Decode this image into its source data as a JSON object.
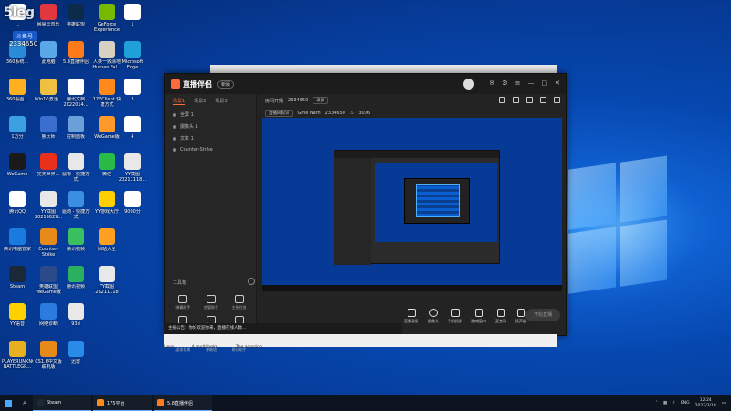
{
  "overlay": {
    "logo_text": "5leg",
    "badge": "斗鱼号",
    "room_id": "2334650"
  },
  "desktop_icons": [
    {
      "label": "...",
      "color": "#ffffff"
    },
    {
      "label": "网易云音乐",
      "color": "#e0383e"
    },
    {
      "label": "英雄联盟",
      "color": "#0c2a4a"
    },
    {
      "label": "GeForce Experience",
      "color": "#76b900"
    },
    {
      "label": "360系统...",
      "color": "#2a8cd8"
    },
    {
      "label": "此电脑",
      "color": "#5aa8e8"
    },
    {
      "label": "5.8直播伴侣",
      "color": "#ff7a1a"
    },
    {
      "label": "人类一败涂地 Human Fal...",
      "color": "#d8d0c0"
    },
    {
      "label": "1",
      "color": "#ffffff"
    },
    {
      "label": "360看图...",
      "color": "#ffb020"
    },
    {
      "label": "Win10激活...",
      "color": "#f0c040"
    },
    {
      "label": "腾讯文档 2022014...",
      "color": "#ffffff"
    },
    {
      "label": "175Client 快捷方式",
      "color": "#ff8a1a"
    },
    {
      "label": "Microsoft Edge",
      "color": "#1fa0d8"
    },
    {
      "label": "1万分",
      "color": "#3aa0e0"
    },
    {
      "label": "鲁大师",
      "color": "#3a6fd0"
    },
    {
      "label": "控制面板",
      "color": "#6a9fd8"
    },
    {
      "label": "WeGame版",
      "color": "#ff9a2a"
    },
    {
      "label": "3",
      "color": "#ffffff"
    },
    {
      "label": "WeGame",
      "color": "#1a1a1a"
    },
    {
      "label": "完美世界...",
      "color": "#e8301a"
    },
    {
      "label": "鼠标 - 快捷方式",
      "color": "#e8e8e8"
    },
    {
      "label": "微信",
      "color": "#2aba4a"
    },
    {
      "label": "4",
      "color": "#ffffff"
    },
    {
      "label": "腾讯QQ",
      "color": "#ffffff"
    },
    {
      "label": "YY截图 20210829...",
      "color": "#e8e8e8"
    },
    {
      "label": "驱动 - 快捷方式",
      "color": "#3a8fe0"
    },
    {
      "label": "YY游戏大厅",
      "color": "#ffd000"
    },
    {
      "label": "YY截图 20211118...",
      "color": "#e8e8e8"
    },
    {
      "label": "腾讯电脑管家",
      "color": "#1a7ae0"
    },
    {
      "label": "Counter-Strike",
      "color": "#e88a1a"
    },
    {
      "label": "腾讯视频",
      "color": "#3ac060"
    },
    {
      "label": "9000分",
      "color": "#ffffff"
    },
    {
      "label": "Steam",
      "color": "#1b2838"
    },
    {
      "label": "英雄联盟WeGame版",
      "color": "#2a4a8a"
    },
    {
      "label": "腾讯视频",
      "color": "#2ab060"
    },
    {
      "label": "网站大全",
      "color": "#ffa020"
    },
    {
      "label": "YY语音",
      "color": "#ffd000"
    },
    {
      "label": "网络诊断",
      "color": "#2a7ae0"
    },
    {
      "label": "93d",
      "color": "#e8e8e8"
    },
    {
      "label": "YY截图 20211118",
      "color": "#e8e8e8"
    },
    {
      "label": "PLAYERUNKNOWN'S BATTLEGR...",
      "color": "#e8b020"
    },
    {
      "label": "CS1.6中文版 联机版",
      "color": "#e88a1a"
    },
    {
      "label": "迅雷",
      "color": "#2a8ae8"
    }
  ],
  "app": {
    "logo": "直播伴侣",
    "version": "新版",
    "scene_tabs": [
      "场景1",
      "场景2",
      "场景3"
    ],
    "sources": [
      "全屏 1",
      "摄像头 1",
      "文本 1",
      "Counter-Strike"
    ],
    "tools_label": "工具箱",
    "tools": [
      "弹幕助手",
      "房管助手",
      "主播任务",
      "视频直播",
      "多人直播",
      "录屏幕",
      "虚拟背景",
      "弹幕墙",
      "歌词助手"
    ],
    "live_info": {
      "label": "房间开播",
      "room": "2334650",
      "chip1": "录屏",
      "chip2": "直播间标识",
      "chip3": "Gme Nam",
      "count1": "2334650",
      "count2": "3006"
    },
    "bottom_tools": [
      "直播录屏",
      "摄像头",
      "手机投屏",
      "游戏窗口",
      "麦克风",
      "扬声器"
    ],
    "start_live": "开始直播",
    "status_text": "主播公告：你好欢迎你来，直播在线人数..."
  },
  "bg_strip_items": [
    "Lens...",
    "A multi helm...",
    "The amazing..."
  ],
  "taskbar": {
    "apps": [
      {
        "label": "Steam",
        "color": "#1b2838"
      },
      {
        "label": "175平台",
        "color": "#ff8a1a"
      },
      {
        "label": "5.8直播伴侣",
        "color": "#ff7a1a"
      }
    ],
    "lang": "ENG",
    "time": "12:24",
    "date": "2022/3/18"
  }
}
